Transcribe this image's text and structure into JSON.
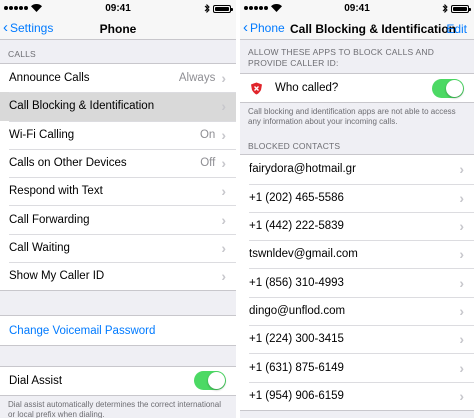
{
  "status": {
    "time": "09:41"
  },
  "left": {
    "nav": {
      "back_label": "Settings",
      "title": "Phone"
    },
    "calls_header": "CALLS",
    "rows": [
      {
        "label": "Announce Calls",
        "value": "Always"
      },
      {
        "label": "Call Blocking & Identification",
        "value": ""
      },
      {
        "label": "Wi-Fi Calling",
        "value": "On"
      },
      {
        "label": "Calls on Other Devices",
        "value": "Off"
      },
      {
        "label": "Respond with Text",
        "value": ""
      },
      {
        "label": "Call Forwarding",
        "value": ""
      },
      {
        "label": "Call Waiting",
        "value": ""
      },
      {
        "label": "Show My Caller ID",
        "value": ""
      }
    ],
    "voicemail_label": "Change Voicemail Password",
    "dial_assist_label": "Dial Assist",
    "dial_assist_on": true,
    "dial_assist_note": "Dial assist automatically determines the correct international or local prefix when dialing."
  },
  "right": {
    "nav": {
      "back_label": "Phone",
      "title": "Call Blocking & Identification",
      "edit_label": "Edit"
    },
    "apps_header": "ALLOW THESE APPS TO BLOCK CALLS AND PROVIDE CALLER ID:",
    "app": {
      "name": "Who called?",
      "enabled": true
    },
    "privacy_note": "Call blocking and identification apps are not able to access any information about your incoming calls.",
    "blocked_header": "BLOCKED CONTACTS",
    "blocked": [
      "fairydora@hotmail.gr",
      "+1 (202) 465-5586",
      "+1 (442) 222-5839",
      "tswnldev@gmail.com",
      "+1 (856) 310-4993",
      "dingo@unflod.com",
      "+1 (224) 300-3415",
      "+1 (631) 875-6149",
      "+1 (954) 906-6159"
    ]
  },
  "colors": {
    "accent": "#007aff",
    "toggle_on": "#4cd964",
    "group_bg": "#efeff4",
    "selected_row": "#d9d9d9"
  }
}
